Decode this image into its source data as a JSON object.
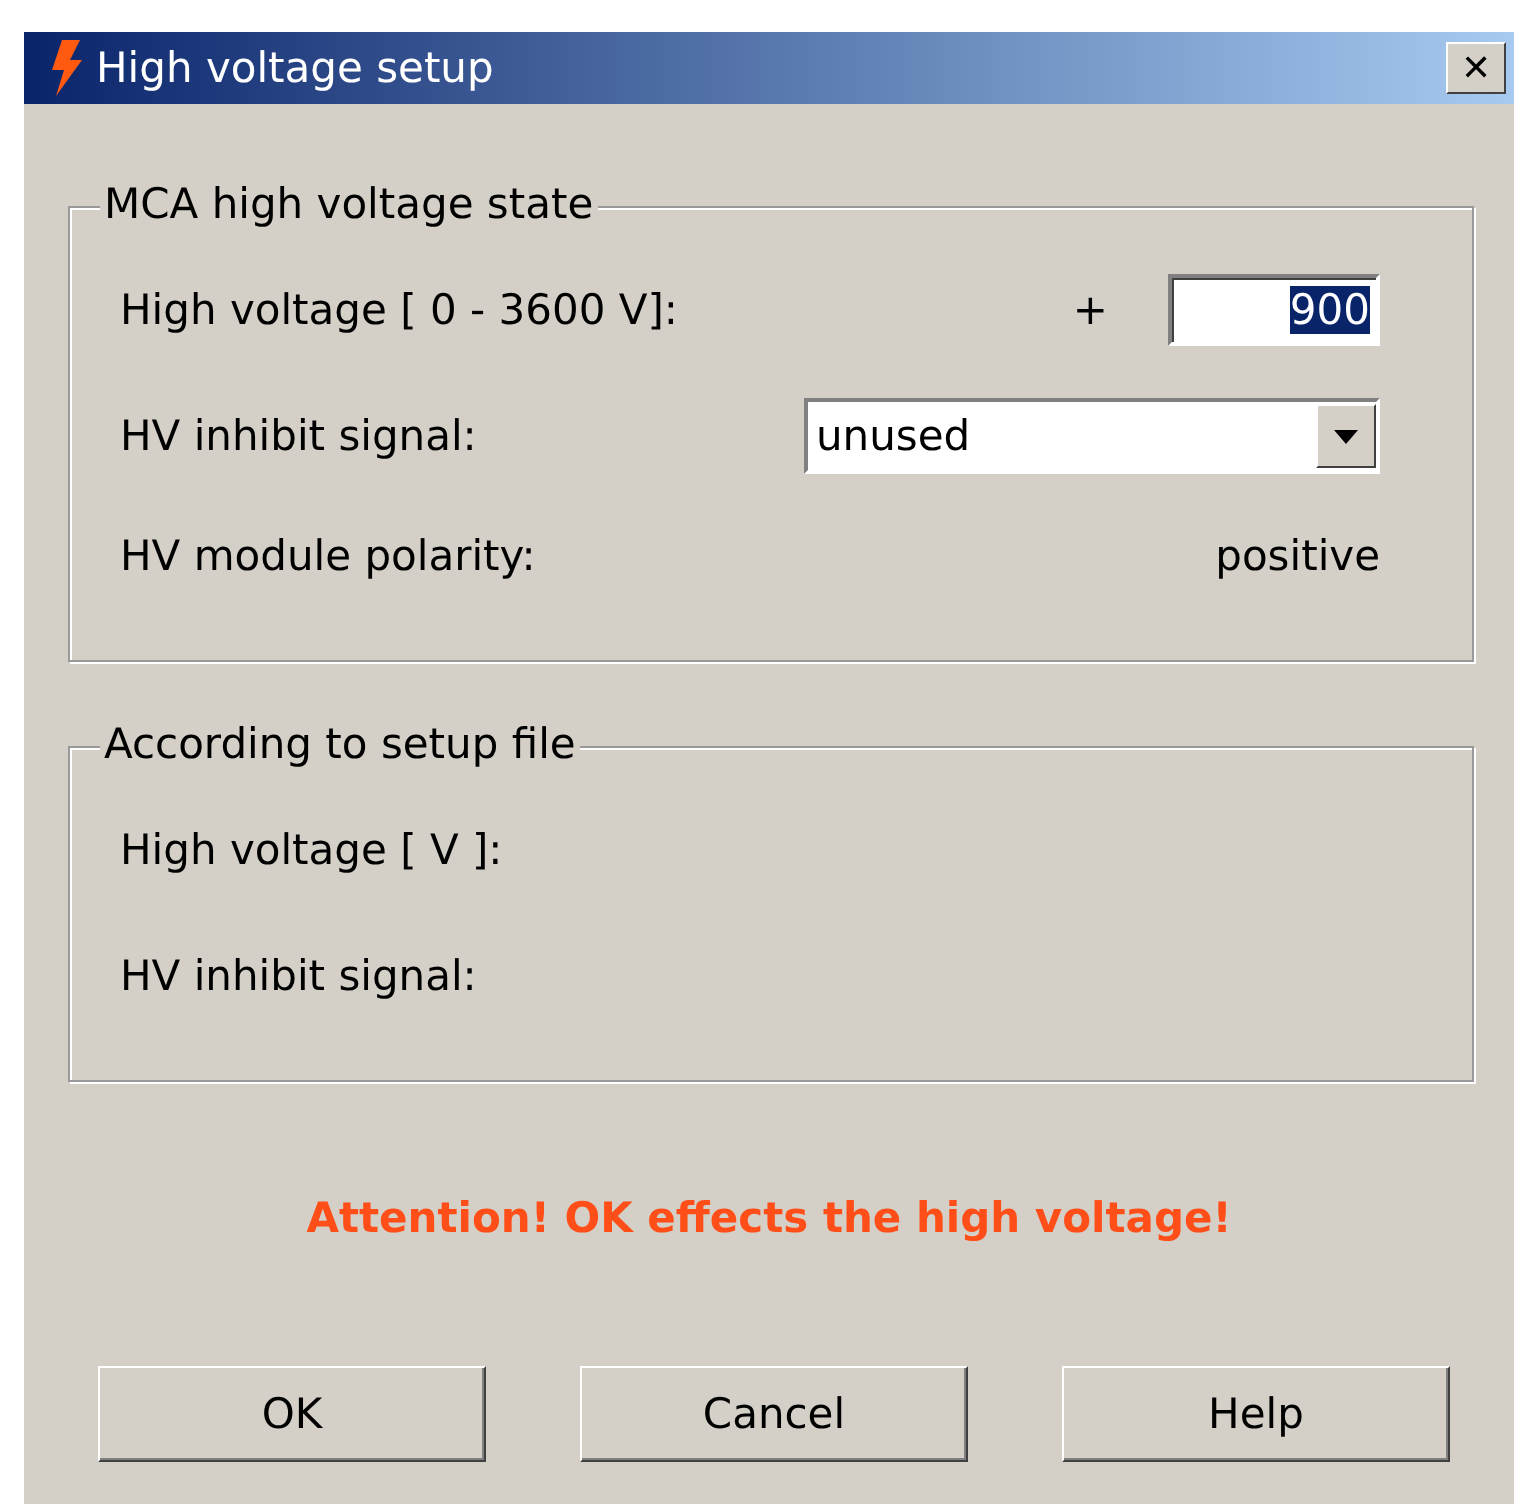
{
  "window": {
    "title": "High voltage setup",
    "close": "✕"
  },
  "groups": [
    {
      "legend": "MCA high voltage state",
      "rows": [
        {
          "kind": "field",
          "label": "High voltage [ 0 - 3600 V]:",
          "prefix": "+",
          "value": "900",
          "value_highlighted": true
        },
        {
          "kind": "select",
          "label": "HV inhibit signal:",
          "value": "unused"
        },
        {
          "kind": "readout",
          "label": "HV module polarity:",
          "value": "positive"
        }
      ]
    },
    {
      "legend": "According to setup file",
      "rows": [
        {
          "kind": "label",
          "label": "High voltage [ V ]:"
        },
        {
          "kind": "label",
          "label": "HV inhibit signal:"
        }
      ]
    }
  ],
  "warning": "Attention! OK effects the high voltage!",
  "buttons": [
    "OK",
    "Cancel",
    "Help"
  ]
}
